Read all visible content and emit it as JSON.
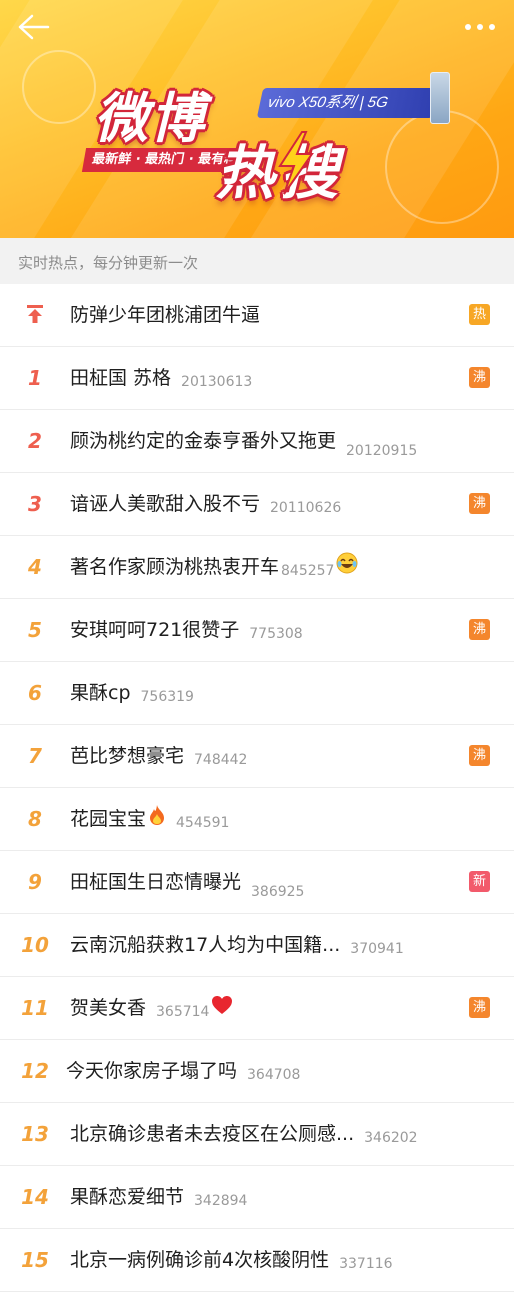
{
  "banner": {
    "title_weibo": "微博",
    "title_resou": "热搜",
    "sponsor": "vivo X50系列 | 5G",
    "slogan": "最新鲜 · 最热门 · 最有料"
  },
  "subheader": {
    "text": "实时热点，每分钟更新一次"
  },
  "items": [
    {
      "rank": "",
      "title": "防弹少年团桃浦团牛逼",
      "count": "",
      "badge": "热",
      "badge_type": "hot"
    },
    {
      "rank": "1",
      "title": "田柾国 苏格",
      "count": "20130613",
      "badge": "沸",
      "badge_type": "boil"
    },
    {
      "rank": "2",
      "title": "顾沩桃约定的金泰亨番外又拖更",
      "count": "20120915",
      "badge": "",
      "badge_type": ""
    },
    {
      "rank": "3",
      "title": "谙诬人美歌甜入股不亏",
      "count": "20110626",
      "badge": "沸",
      "badge_type": "boil"
    },
    {
      "rank": "4",
      "title": "著名作家顾沩桃热衷开车",
      "count": "845257",
      "badge": "",
      "badge_type": "",
      "emoji": "laugh-cry"
    },
    {
      "rank": "5",
      "title": "安琪呵呵721很赞子",
      "count": "775308",
      "badge": "沸",
      "badge_type": "boil"
    },
    {
      "rank": "6",
      "title": "果酥cp",
      "count": "756319",
      "badge": "",
      "badge_type": ""
    },
    {
      "rank": "7",
      "title": "芭比梦想豪宅",
      "count": "748442",
      "badge": "沸",
      "badge_type": "boil"
    },
    {
      "rank": "8",
      "title": "花园宝宝",
      "count": "454591",
      "badge": "",
      "badge_type": "",
      "emoji": "fire"
    },
    {
      "rank": "9",
      "title": "田柾国生日恋情曝光",
      "count": "386925",
      "badge": "新",
      "badge_type": "new"
    },
    {
      "rank": "10",
      "title": "云南沉船获救17人均为中国籍...",
      "count": "370941",
      "badge": "",
      "badge_type": ""
    },
    {
      "rank": "11",
      "title": "贺美女香",
      "count": "365714",
      "badge": "沸",
      "badge_type": "boil",
      "emoji": "heart"
    },
    {
      "rank": "12",
      "title": "今天你家房子塌了吗",
      "count": "364708",
      "badge": "",
      "badge_type": ""
    },
    {
      "rank": "13",
      "title": "北京确诊患者未去疫区在公厕感...",
      "count": "346202",
      "badge": "",
      "badge_type": ""
    },
    {
      "rank": "14",
      "title": "果酥恋爱细节",
      "count": "342894",
      "badge": "",
      "badge_type": ""
    },
    {
      "rank": "15",
      "title": "北京一病例确诊前4次核酸阴性",
      "count": "337116",
      "badge": "",
      "badge_type": ""
    }
  ],
  "colors": {
    "rank_top": "#ee5f4f",
    "rank_rest": "#f3a23a",
    "badge_hot": "#f7a725",
    "badge_boil": "#f4862d",
    "badge_new": "#f25a6b"
  }
}
